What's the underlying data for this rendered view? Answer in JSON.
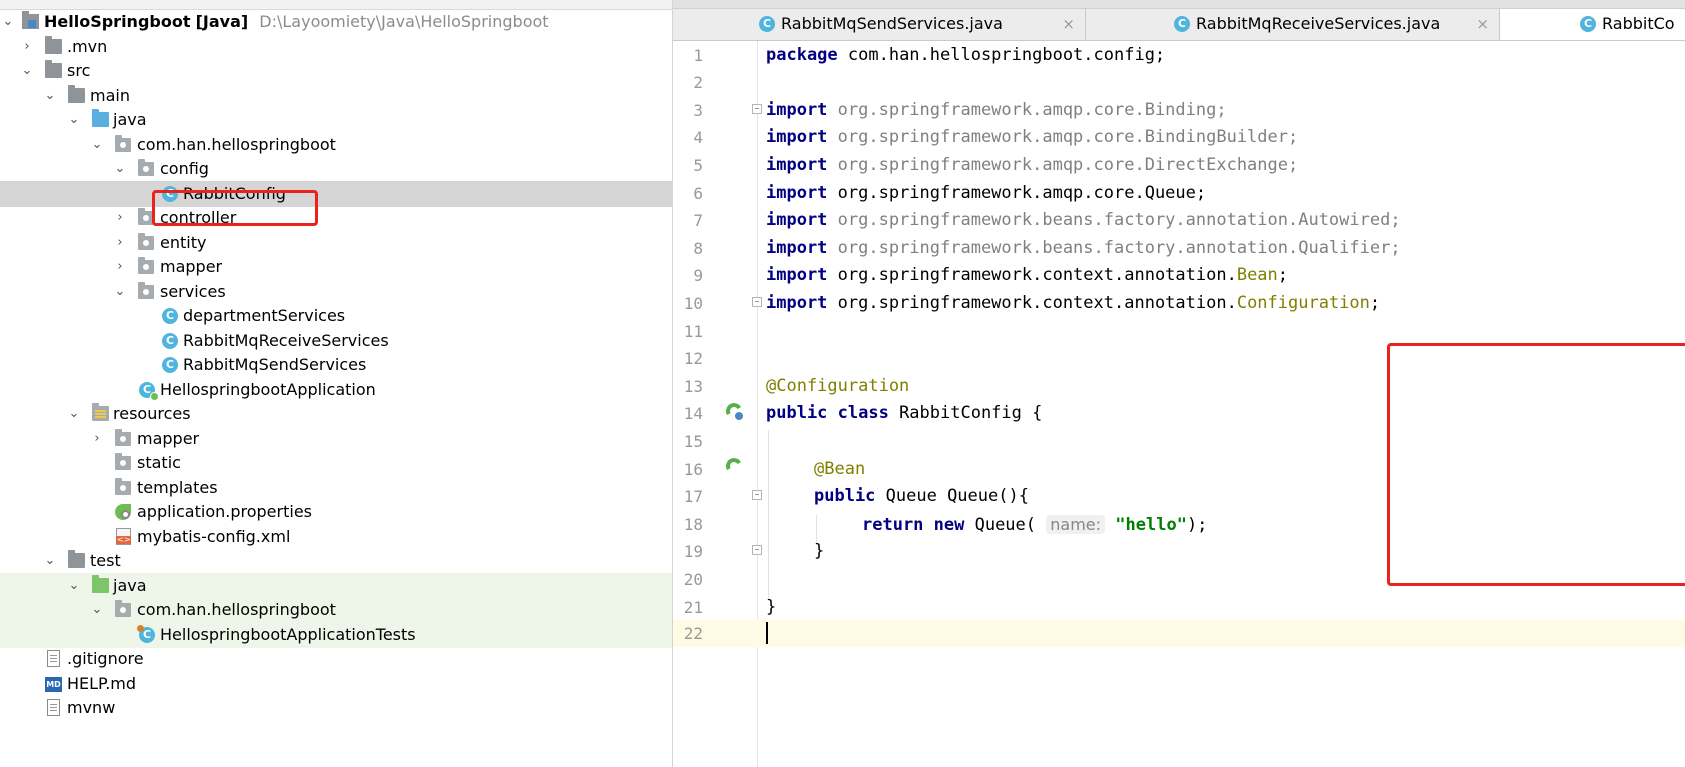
{
  "project_tree": {
    "root": {
      "name": "HelloSpringboot",
      "qualifier": "[Java]",
      "path": "D:\\Layoomiety\\Java\\HelloSpringboot"
    },
    "rows": [
      {
        "label": ".mvn"
      },
      {
        "label": "src"
      },
      {
        "label": "main"
      },
      {
        "label": "java"
      },
      {
        "label": "com.han.hellospringboot"
      },
      {
        "label": "config"
      },
      {
        "label": "RabbitConfig"
      },
      {
        "label": "controller"
      },
      {
        "label": "entity"
      },
      {
        "label": "mapper"
      },
      {
        "label": "services"
      },
      {
        "label": "departmentServices"
      },
      {
        "label": "RabbitMqReceiveServices"
      },
      {
        "label": "RabbitMqSendServices"
      },
      {
        "label": "HellospringbootApplication"
      },
      {
        "label": "resources"
      },
      {
        "label": "mapper"
      },
      {
        "label": "static"
      },
      {
        "label": "templates"
      },
      {
        "label": "application.properties"
      },
      {
        "label": "mybatis-config.xml"
      },
      {
        "label": "test"
      },
      {
        "label": "java"
      },
      {
        "label": "com.han.hellospringboot"
      },
      {
        "label": "HellospringbootApplicationTests"
      },
      {
        "label": ".gitignore"
      },
      {
        "label": "HELP.md"
      },
      {
        "label": "mvnw"
      }
    ]
  },
  "editor": {
    "tabs": [
      {
        "label": "RabbitMqSendServices.java",
        "close": "×"
      },
      {
        "label": "RabbitMqReceiveServices.java",
        "close": "×"
      },
      {
        "label": "RabbitCo"
      }
    ],
    "line_numbers": [
      "1",
      "2",
      "3",
      "4",
      "5",
      "6",
      "7",
      "8",
      "9",
      "10",
      "11",
      "12",
      "13",
      "14",
      "15",
      "16",
      "17",
      "18",
      "19",
      "20",
      "21",
      "22"
    ],
    "code": {
      "l1_kw": "package",
      "l1_rest": " com.han.hellospringboot.config;",
      "import_kw": "import",
      "l3": " org.springframework.amqp.core.Binding;",
      "l4": " org.springframework.amqp.core.BindingBuilder;",
      "l5": " org.springframework.amqp.core.DirectExchange;",
      "l6": " org.springframework.amqp.core.Queue;",
      "l7": " org.springframework.beans.factory.annotation.Autowired;",
      "l8": " org.springframework.beans.factory.annotation.Qualifier;",
      "l9_pre": " org.springframework.context.annotation.",
      "l9_ann": "Bean",
      "l9_end": ";",
      "l10_pre": " org.springframework.context.annotation.",
      "l10_ann": "Configuration",
      "l10_end": ";",
      "l13_ann": "@Configuration",
      "l14_kw": "public class",
      "l14_rest": " RabbitConfig {",
      "l16_ann": "@Bean",
      "l17_kw": "public",
      "l17_rest": " Queue Queue(){",
      "l18_kw": "return new",
      "l18_pre": " Queue(",
      "l18_hint": "name:",
      "l18_str": "\"hello\"",
      "l18_end": ");",
      "l19": "}",
      "l21": "}"
    },
    "colors": {
      "keyword": "#000080",
      "unused_import": "#808080",
      "annotation": "#808000",
      "string": "#008000",
      "highlight_box": "#e8231d",
      "current_line": "#fffae3"
    }
  }
}
